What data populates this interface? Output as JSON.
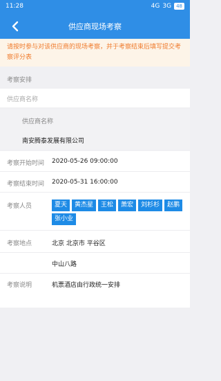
{
  "status_bar": {
    "time": "11:28",
    "signal_1": "4G",
    "signal_2": "3G",
    "battery": "48"
  },
  "header": {
    "title": "供应商现场考察"
  },
  "notice": {
    "text": "请按时参与对该供应商的现场考察，并于考察结束后填写提交考察评分表"
  },
  "section": {
    "title": "考察安排"
  },
  "supplier": {
    "caption": "供应商名称",
    "label": "供应商名称",
    "value": "南安腾泰发展有限公司"
  },
  "schedule": {
    "start_label": "考察开始时间",
    "start_value": "2020-05-26 09:00:00",
    "end_label": "考察结束时间",
    "end_value": "2020-05-31 16:00:00"
  },
  "staff": {
    "label": "考察人员",
    "members": [
      "夏天",
      "黄杰星",
      "王松",
      "萧宏",
      "刘杉杉",
      "赵鹏",
      "张小业"
    ]
  },
  "location": {
    "label": "考察地点",
    "region": "北京 北京市 平谷区",
    "street": "中山八路"
  },
  "description": {
    "label": "考察说明",
    "value": "机票酒店由行政统一安排"
  },
  "colors": {
    "primary": "#2f8ee6",
    "tag": "#1e8be6",
    "notice_text": "#ef7b2d",
    "notice_bg": "#fdf4e8"
  }
}
